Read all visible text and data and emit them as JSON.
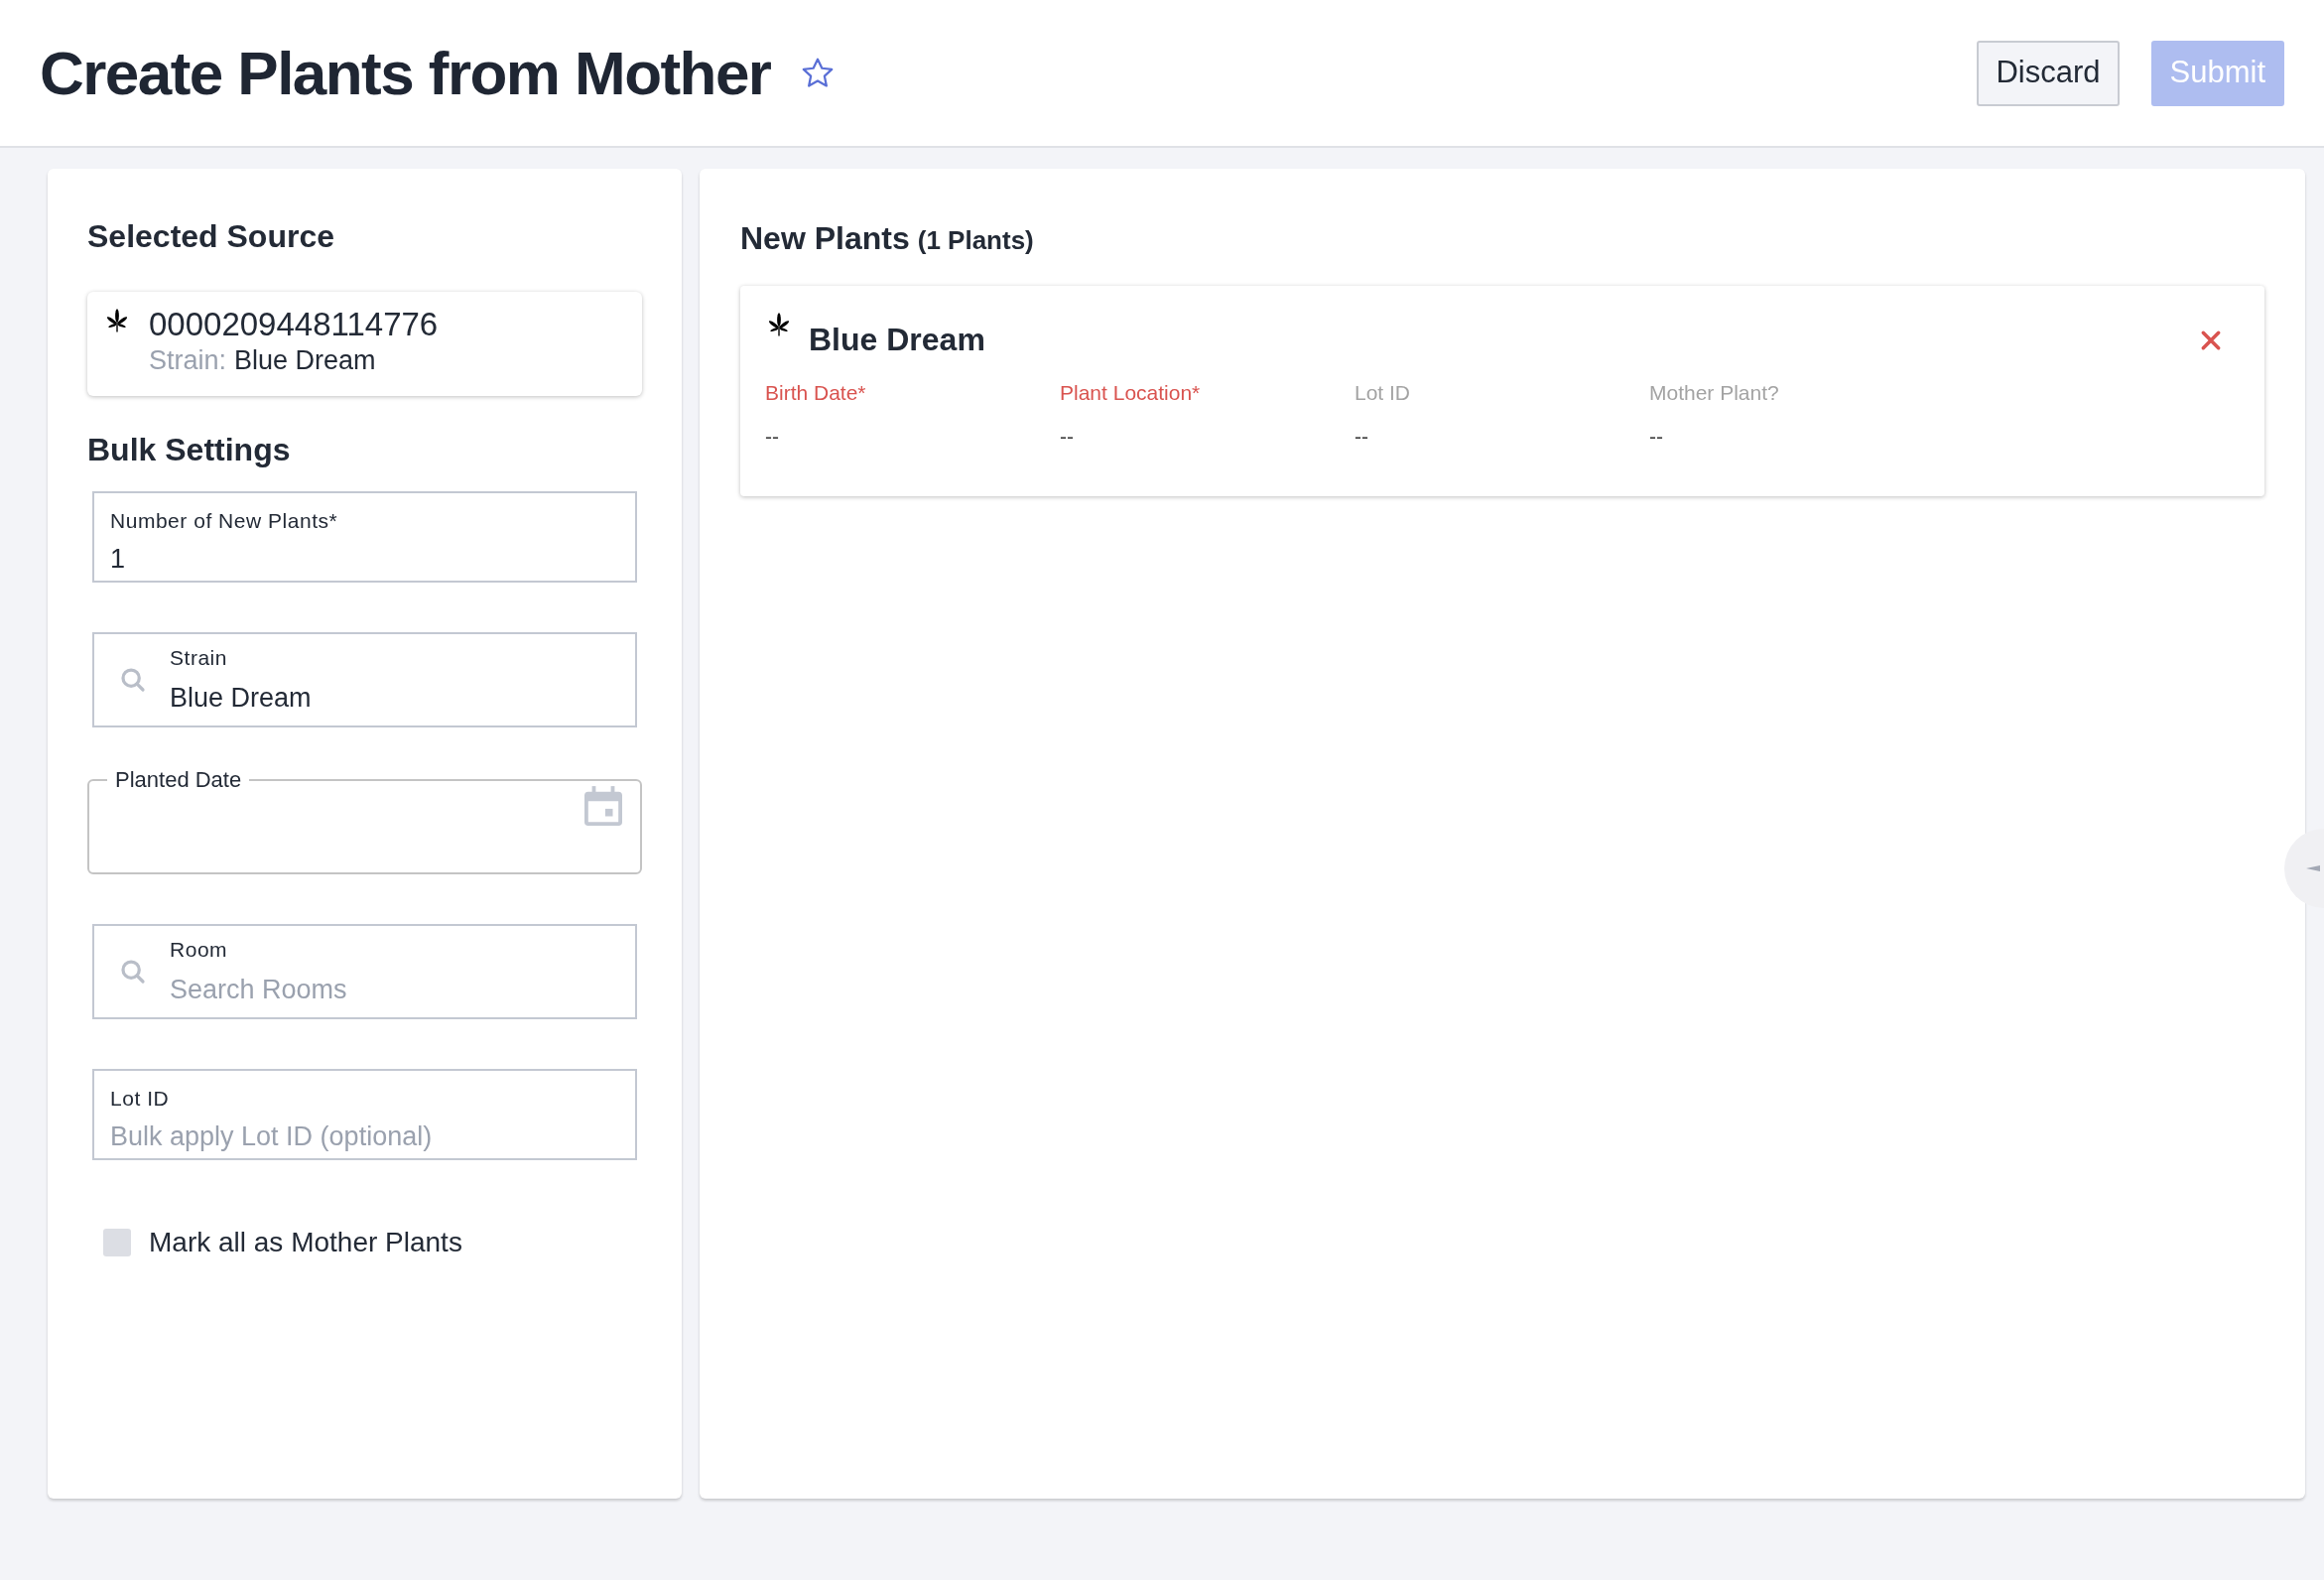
{
  "header": {
    "title": "Create Plants from Mother",
    "favorite": false,
    "buttons": [
      {
        "label": "Discard",
        "kind": "secondary",
        "disabled": false
      },
      {
        "label": "Submit",
        "kind": "primary",
        "disabled": true
      }
    ]
  },
  "source_panel": {
    "heading": "Selected Source",
    "source": {
      "id": "0000209448114776",
      "strain_label": "Strain:",
      "strain": "Blue Dream"
    }
  },
  "bulk_settings": {
    "heading": "Bulk Settings",
    "fields": [
      {
        "kind": "text",
        "label": "Number of New Plants*",
        "value": "1"
      },
      {
        "kind": "search",
        "label": "Strain",
        "value": "Blue Dream"
      },
      {
        "kind": "date",
        "label": "Planted Date"
      },
      {
        "kind": "search",
        "label": "Room",
        "placeholder": "Search Rooms"
      },
      {
        "kind": "text",
        "label": "Lot ID",
        "placeholder": "Bulk apply Lot ID (optional)"
      }
    ],
    "mother_checkbox": {
      "label": "Mark all as Mother Plants",
      "checked": false
    }
  },
  "new_plants": {
    "heading": "New Plants",
    "count": "(1 Plants)",
    "plants": [
      {
        "name": "Blue Dream",
        "fields": [
          {
            "label": "Birth Date*",
            "value": "--",
            "required": true
          },
          {
            "label": "Plant Location*",
            "value": "--",
            "required": true
          },
          {
            "label": "Lot ID",
            "value": "--",
            "required": false
          },
          {
            "label": "Mother Plant?",
            "value": "--",
            "required": false
          }
        ]
      }
    ]
  }
}
